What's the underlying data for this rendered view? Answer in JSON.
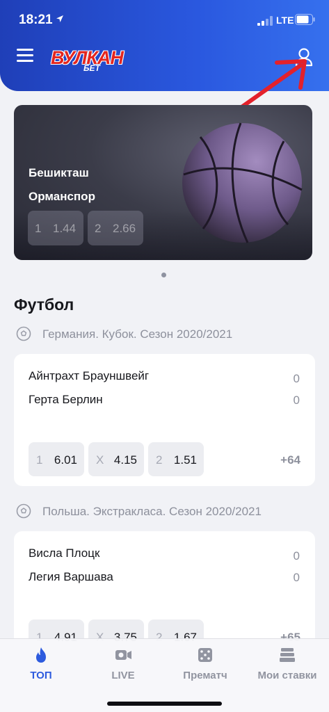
{
  "status_bar": {
    "time": "18:21",
    "network": "LTE"
  },
  "header": {
    "logo_main": "ВУЛКАН",
    "logo_sub": "БЕТ"
  },
  "banner": {
    "team_home": "Бешикташ",
    "team_away": "Орманспор",
    "odds": [
      {
        "label": "1",
        "value": "1.44"
      },
      {
        "label": "2",
        "value": "2.66"
      }
    ]
  },
  "sport": {
    "title": "Футбол"
  },
  "leagues": [
    {
      "name": "Германия. Кубок. Сезон 2020/2021",
      "match": {
        "team_home": "Айнтрахт Брауншвейг",
        "team_away": "Герта Берлин",
        "score_home": "0",
        "score_away": "0",
        "odds": [
          {
            "label": "1",
            "value": "6.01"
          },
          {
            "label": "X",
            "value": "4.15"
          },
          {
            "label": "2",
            "value": "1.51"
          }
        ],
        "more": "+64"
      }
    },
    {
      "name": "Польша. Экстракласа. Сезон 2020/2021",
      "match": {
        "team_home": "Висла Плоцк",
        "team_away": "Легия Варшава",
        "score_home": "0",
        "score_away": "0",
        "odds": [
          {
            "label": "1",
            "value": "4.91"
          },
          {
            "label": "X",
            "value": "3.75"
          },
          {
            "label": "2",
            "value": "1.67"
          }
        ],
        "more": "+65"
      }
    }
  ],
  "tabbar": {
    "tabs": [
      {
        "label": "ТОП",
        "icon": "flame-icon",
        "active": true
      },
      {
        "label": "LIVE",
        "icon": "video-camera-icon",
        "active": false
      },
      {
        "label": "Прематч",
        "icon": "dice-icon",
        "active": false
      },
      {
        "label": "Мои ставки",
        "icon": "ticket-stack-icon",
        "active": false
      }
    ]
  },
  "colors": {
    "accent": "#2d5bde",
    "header_start": "#1f3fb8",
    "header_end": "#3670ee",
    "logo_red": "#e4261f",
    "annotation_red": "#e3212b"
  }
}
